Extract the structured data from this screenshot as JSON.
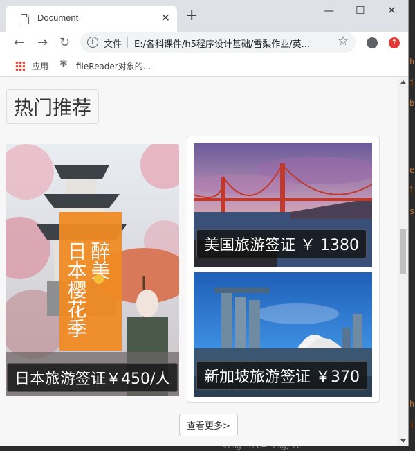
{
  "browser": {
    "tab_title": "Document",
    "tab_close": "✕",
    "new_tab": "+",
    "win_min": "—",
    "win_max": "☐",
    "win_close": "✕",
    "nav_back": "←",
    "nav_forward": "→",
    "nav_reload": "↻",
    "info_icon": "i",
    "file_label": "文件",
    "url": "E:/各科课件/h5程序设计基础/雪梨作业/英...",
    "star": "☆",
    "bookmark_apps": "应用",
    "bookmark_item": "fileReader对象的...",
    "bookmark_gear": "❃"
  },
  "page": {
    "section_title": "热门推荐",
    "cards": [
      {
        "caption": "日本旅游签证￥450/人",
        "image": "japan-cherry-blossom"
      },
      {
        "caption": "美国旅游签证 ￥ 1380",
        "image": "golden-gate-bridge"
      },
      {
        "caption": "新加坡旅游签证 ￥370",
        "image": "marina-bay-sands"
      }
    ],
    "more_button": "查看更多>",
    "poster_text_1": "醉美",
    "poster_text_2": "日本樱花季"
  },
  "editor": {
    "bottom_code": "<img src= img/ic"
  },
  "colors": {
    "accent_orange": "#f08a24",
    "sky_purple": "#8a6aa8",
    "sky_blue": "#2f7fd6",
    "bridge_red": "#c0392b"
  }
}
